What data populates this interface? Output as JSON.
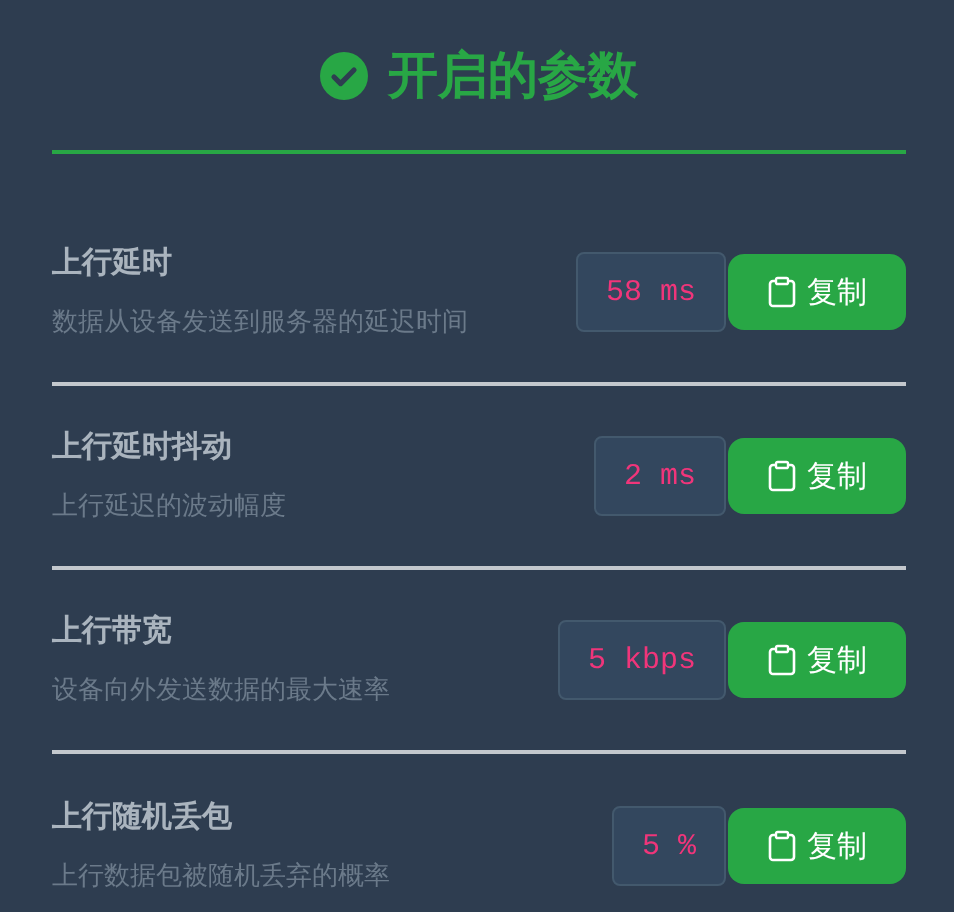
{
  "header": {
    "title": "开启的参数"
  },
  "params": [
    {
      "name": "上行延时",
      "description": "数据从设备发送到服务器的延迟时间",
      "value": "58 ms",
      "button": "复制"
    },
    {
      "name": "上行延时抖动",
      "description": "上行延迟的波动幅度",
      "value": "2 ms",
      "button": "复制"
    },
    {
      "name": "上行带宽",
      "description": "设备向外发送数据的最大速率",
      "value": "5 kbps",
      "button": "复制"
    },
    {
      "name": "上行随机丢包",
      "description": "上行数据包被随机丢弃的概率",
      "value": "5 %",
      "button": "复制"
    }
  ]
}
